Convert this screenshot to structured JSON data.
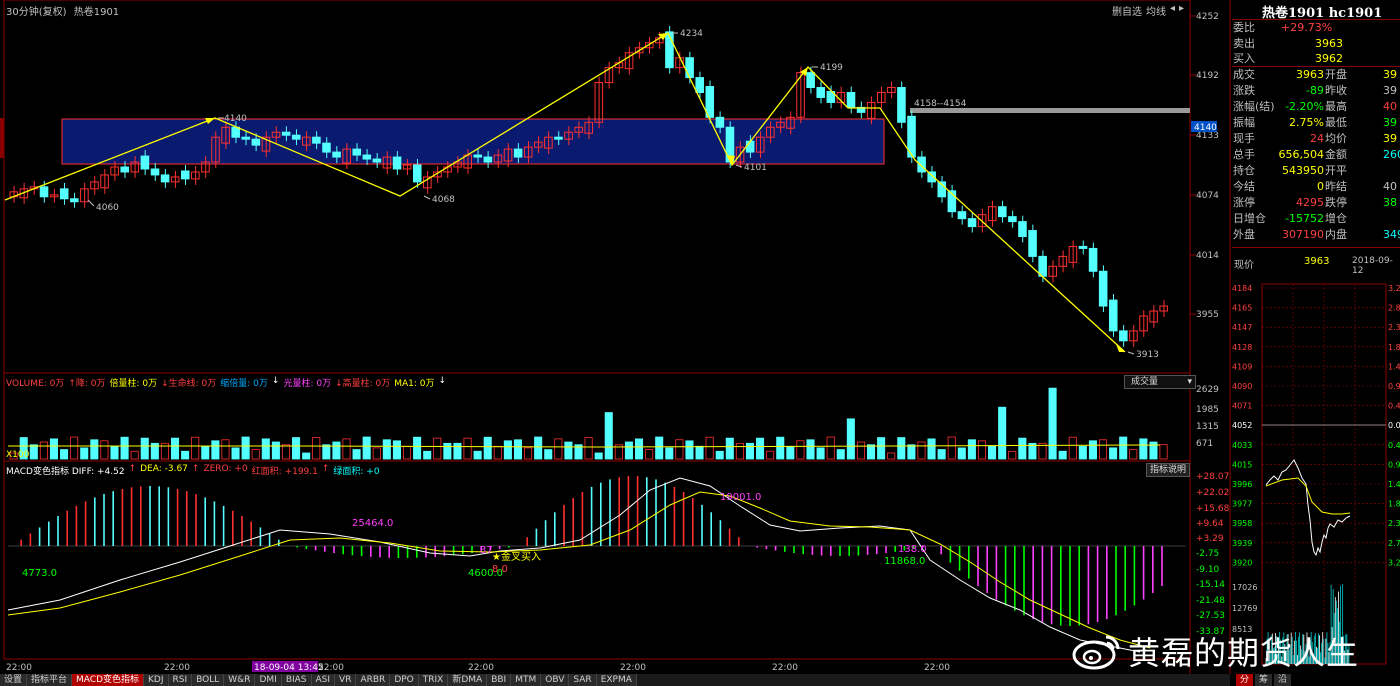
{
  "chart_header": {
    "period": "30分钟(复权)",
    "symbol": "热卷1901",
    "toolbar": [
      "删自选",
      "均线",
      "◂",
      "▸"
    ]
  },
  "price_axis": [
    "4252",
    "4192",
    "4140",
    "4133",
    "4074",
    "4014",
    "3955"
  ],
  "price_tag": "4140",
  "annotations": {
    "p4060": "4060",
    "p4140": "4140",
    "p4068": "4068",
    "p4234": "4234",
    "p4101": "4101",
    "p4199": "4199",
    "p3913": "3913",
    "range": "4158--4154"
  },
  "volume_header": {
    "items": [
      {
        "t": "VOLUME: 0万",
        "c": "#ff4040"
      },
      {
        "t": "↑降: 0万",
        "c": "#ff4040"
      },
      {
        "t": "倍量柱: 0万",
        "c": "#ffff00"
      },
      {
        "t": "↓生命线: 0万",
        "c": "#ff4040"
      },
      {
        "t": "缩倍量: 0万",
        "c": "#00aaff"
      },
      {
        "t": "↓",
        "c": "#ffffff"
      },
      {
        "t": "光量柱: 0万",
        "c": "#ff40ff"
      },
      {
        "t": "↓高量柱: 0万",
        "c": "#ff4040"
      },
      {
        "t": "MA1: 0万",
        "c": "#ffff00"
      },
      {
        "t": "↓",
        "c": "#ffffff"
      }
    ],
    "dropdown": "成交量"
  },
  "volume_axis": [
    "2629",
    "1985",
    "1315",
    "671",
    "X100"
  ],
  "macd_header": {
    "items": [
      {
        "t": "MACD变色指标 DIFF: +4.52",
        "c": "#ffffff"
      },
      {
        "t": "↑",
        "c": "#ff4040"
      },
      {
        "t": "DEA: -3.67",
        "c": "#ffff00"
      },
      {
        "t": "↑",
        "c": "#ff4040"
      },
      {
        "t": "ZERO: +0",
        "c": "#ff4040"
      },
      {
        "t": "红面积: +199.1",
        "c": "#ff4040"
      },
      {
        "t": "↑",
        "c": "#ff4040"
      },
      {
        "t": "绿面积: +0",
        "c": "#00ffff"
      }
    ],
    "explain_button": "指标说明"
  },
  "macd_axis": [
    "+28.07",
    "+22.02",
    "+15.68",
    "+9.64",
    "+3.29",
    "-2.75",
    "-9.10",
    "-15.14",
    "-21.48",
    "-27.53",
    "-33.87"
  ],
  "macd_labels": {
    "l1": "4773.0",
    "l2": "25464.0",
    "l3": "4600.0",
    "l4": "8.0",
    "l5": "19001.0",
    "l6": "11868.0",
    "l7": "138.0",
    "signal": "★金叉买入",
    "l8": "37"
  },
  "time_axis": [
    "22:00",
    "22:00",
    "22:00",
    "22:00",
    "22:00",
    "22:00",
    "22:00"
  ],
  "cursor_time": "18-09-04 13:45",
  "tabs": [
    "设置",
    "指标平台",
    "MACD变色指标",
    "KDJ",
    "RSI",
    "BOLL",
    "W&R",
    "DMI",
    "BIAS",
    "ASI",
    "VR",
    "ARBR",
    "DPO",
    "TRIX",
    "新DMA",
    "BBI",
    "MTM",
    "OBV",
    "SAR",
    "EXPMA"
  ],
  "active_tab": "MACD变色指标",
  "quote": {
    "title": "热卷1901 hc1901",
    "weibi_label": "委比",
    "weibi_value": "+29.73%",
    "sell_label": "卖出",
    "sell_value": "3963",
    "buy_label": "买入",
    "buy_value": "3962",
    "rows": [
      {
        "l": "成交",
        "v": "3963",
        "vc": "#ffff00",
        "l2": "开盘",
        "v2": "39",
        "v2c": "#ffff00"
      },
      {
        "l": "涨跌",
        "v": "-89",
        "vc": "#00ff00",
        "l2": "昨收",
        "v2": "39",
        "v2c": "#c0c0c0"
      },
      {
        "l": "涨幅(结)",
        "v": "-2.20%",
        "vc": "#00ff00",
        "l2": "最高",
        "v2": "40",
        "v2c": "#ff4040"
      },
      {
        "l": "振幅",
        "v": "2.75%",
        "vc": "#ffff00",
        "l2": "最低",
        "v2": "39",
        "v2c": "#00ff00"
      },
      {
        "l": "现手",
        "v": "24",
        "vc": "#ff4040",
        "l2": "均价",
        "v2": "39",
        "v2c": "#ffff00"
      },
      {
        "l": "总手",
        "v": "656,504",
        "vc": "#ffff00",
        "l2": "金额",
        "v2": "260.",
        "v2c": "#00ffff"
      },
      {
        "l": "持仓",
        "v": "543950",
        "vc": "#ffff00",
        "l2": "开平",
        "v2": "",
        "v2c": "#c0c0c0"
      },
      {
        "l": "今结",
        "v": "0",
        "vc": "#ffff00",
        "l2": "昨结",
        "v2": "40",
        "v2c": "#c0c0c0"
      },
      {
        "l": "涨停",
        "v": "4295",
        "vc": "#ff4040",
        "l2": "跌停",
        "v2": "38",
        "v2c": "#00ff00"
      },
      {
        "l": "日增仓",
        "v": "-15752",
        "vc": "#00ff00",
        "l2": "增仓",
        "v2": "",
        "v2c": "#c0c0c0"
      },
      {
        "l": "外盘",
        "v": "307190",
        "vc": "#ff4040",
        "l2": "内盘",
        "v2": "3493",
        "v2c": "#00ffff"
      }
    ],
    "current_label": "现价",
    "current_value": "3963",
    "date": "2018-09-12"
  },
  "mini_axis_left": [
    "4184",
    "4165",
    "4147",
    "4128",
    "4109",
    "4090",
    "4071",
    "4052",
    "4033",
    "4015",
    "3996",
    "3977",
    "3958",
    "3939",
    "3920"
  ],
  "mini_axis_right": [
    "3.26",
    "2.80",
    "2.33",
    "1.87",
    "1.41",
    "0.93",
    "0.47",
    "0.00",
    "0.47",
    "0.93",
    "1.41",
    "1.87",
    "2.33",
    "2.79",
    "3.26"
  ],
  "mini_vol_axis": [
    "17026",
    "12769",
    "8513"
  ],
  "bottom_tabs": [
    "分",
    "筹",
    "沿"
  ],
  "watermark": "黄磊的期货人生"
}
